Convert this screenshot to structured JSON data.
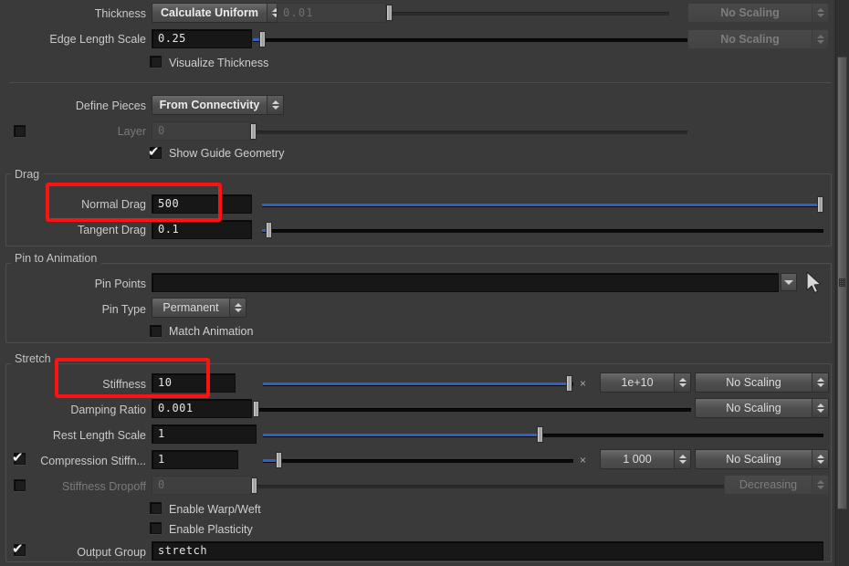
{
  "app": {
    "accent_blue": "#2f62c4",
    "highlight_red": "#fb1212",
    "panel_bg": "#3a3a3a"
  },
  "rows": {
    "thickness": {
      "label": "Thickness",
      "menu_value": "Calculate Uniform",
      "field_value": "0.01",
      "scaling": "No Scaling"
    },
    "edge_length_scale": {
      "label": "Edge Length Scale",
      "value": "0.25"
    },
    "visualize_thickness": {
      "label": "Visualize Thickness",
      "checked": "false"
    },
    "define_pieces": {
      "label": "Define Pieces",
      "menu_value": "From Connectivity"
    },
    "layer": {
      "label": "Layer",
      "value": "0",
      "checked": "false"
    },
    "show_guide_geometry": {
      "label": "Show Guide Geometry",
      "checked": "true"
    }
  },
  "drag_section": {
    "title": "Drag",
    "normal_drag": {
      "label": "Normal Drag",
      "value": "500"
    },
    "tangent_drag": {
      "label": "Tangent Drag",
      "value": "0.1"
    }
  },
  "pin_section": {
    "title": "Pin to Animation",
    "pin_points": {
      "label": "Pin Points",
      "value": ""
    },
    "pin_type": {
      "label": "Pin Type",
      "menu_value": "Permanent"
    },
    "match_animation": {
      "label": "Match Animation",
      "checked": "false"
    }
  },
  "stretch_section": {
    "title": "Stretch",
    "stiffness": {
      "label": "Stiffness",
      "value": "10",
      "multiplier_glyph": "×",
      "multiplier": "1e+10",
      "scaling": "No Scaling"
    },
    "damping_ratio": {
      "label": "Damping Ratio",
      "value": "0.001",
      "scaling": "No Scaling"
    },
    "rest_length_scale": {
      "label": "Rest Length Scale",
      "value": "1"
    },
    "compression_stiffness": {
      "label": "Compression Stiffn...",
      "value": "1",
      "checked": "true",
      "multiplier_glyph": "×",
      "multiplier": "1 000",
      "scaling": "No Scaling"
    },
    "stiffness_dropoff": {
      "label": "Stiffness Dropoff",
      "value": "0",
      "checked": "false",
      "mode": "Decreasing"
    },
    "enable_warp_weft": {
      "label": "Enable Warp/Weft",
      "checked": "false"
    },
    "enable_plasticity": {
      "label": "Enable Plasticity",
      "checked": "false"
    },
    "output_group": {
      "label": "Output Group",
      "value": "stretch",
      "checked": "true"
    }
  },
  "glyphs": {
    "check": "✔"
  }
}
